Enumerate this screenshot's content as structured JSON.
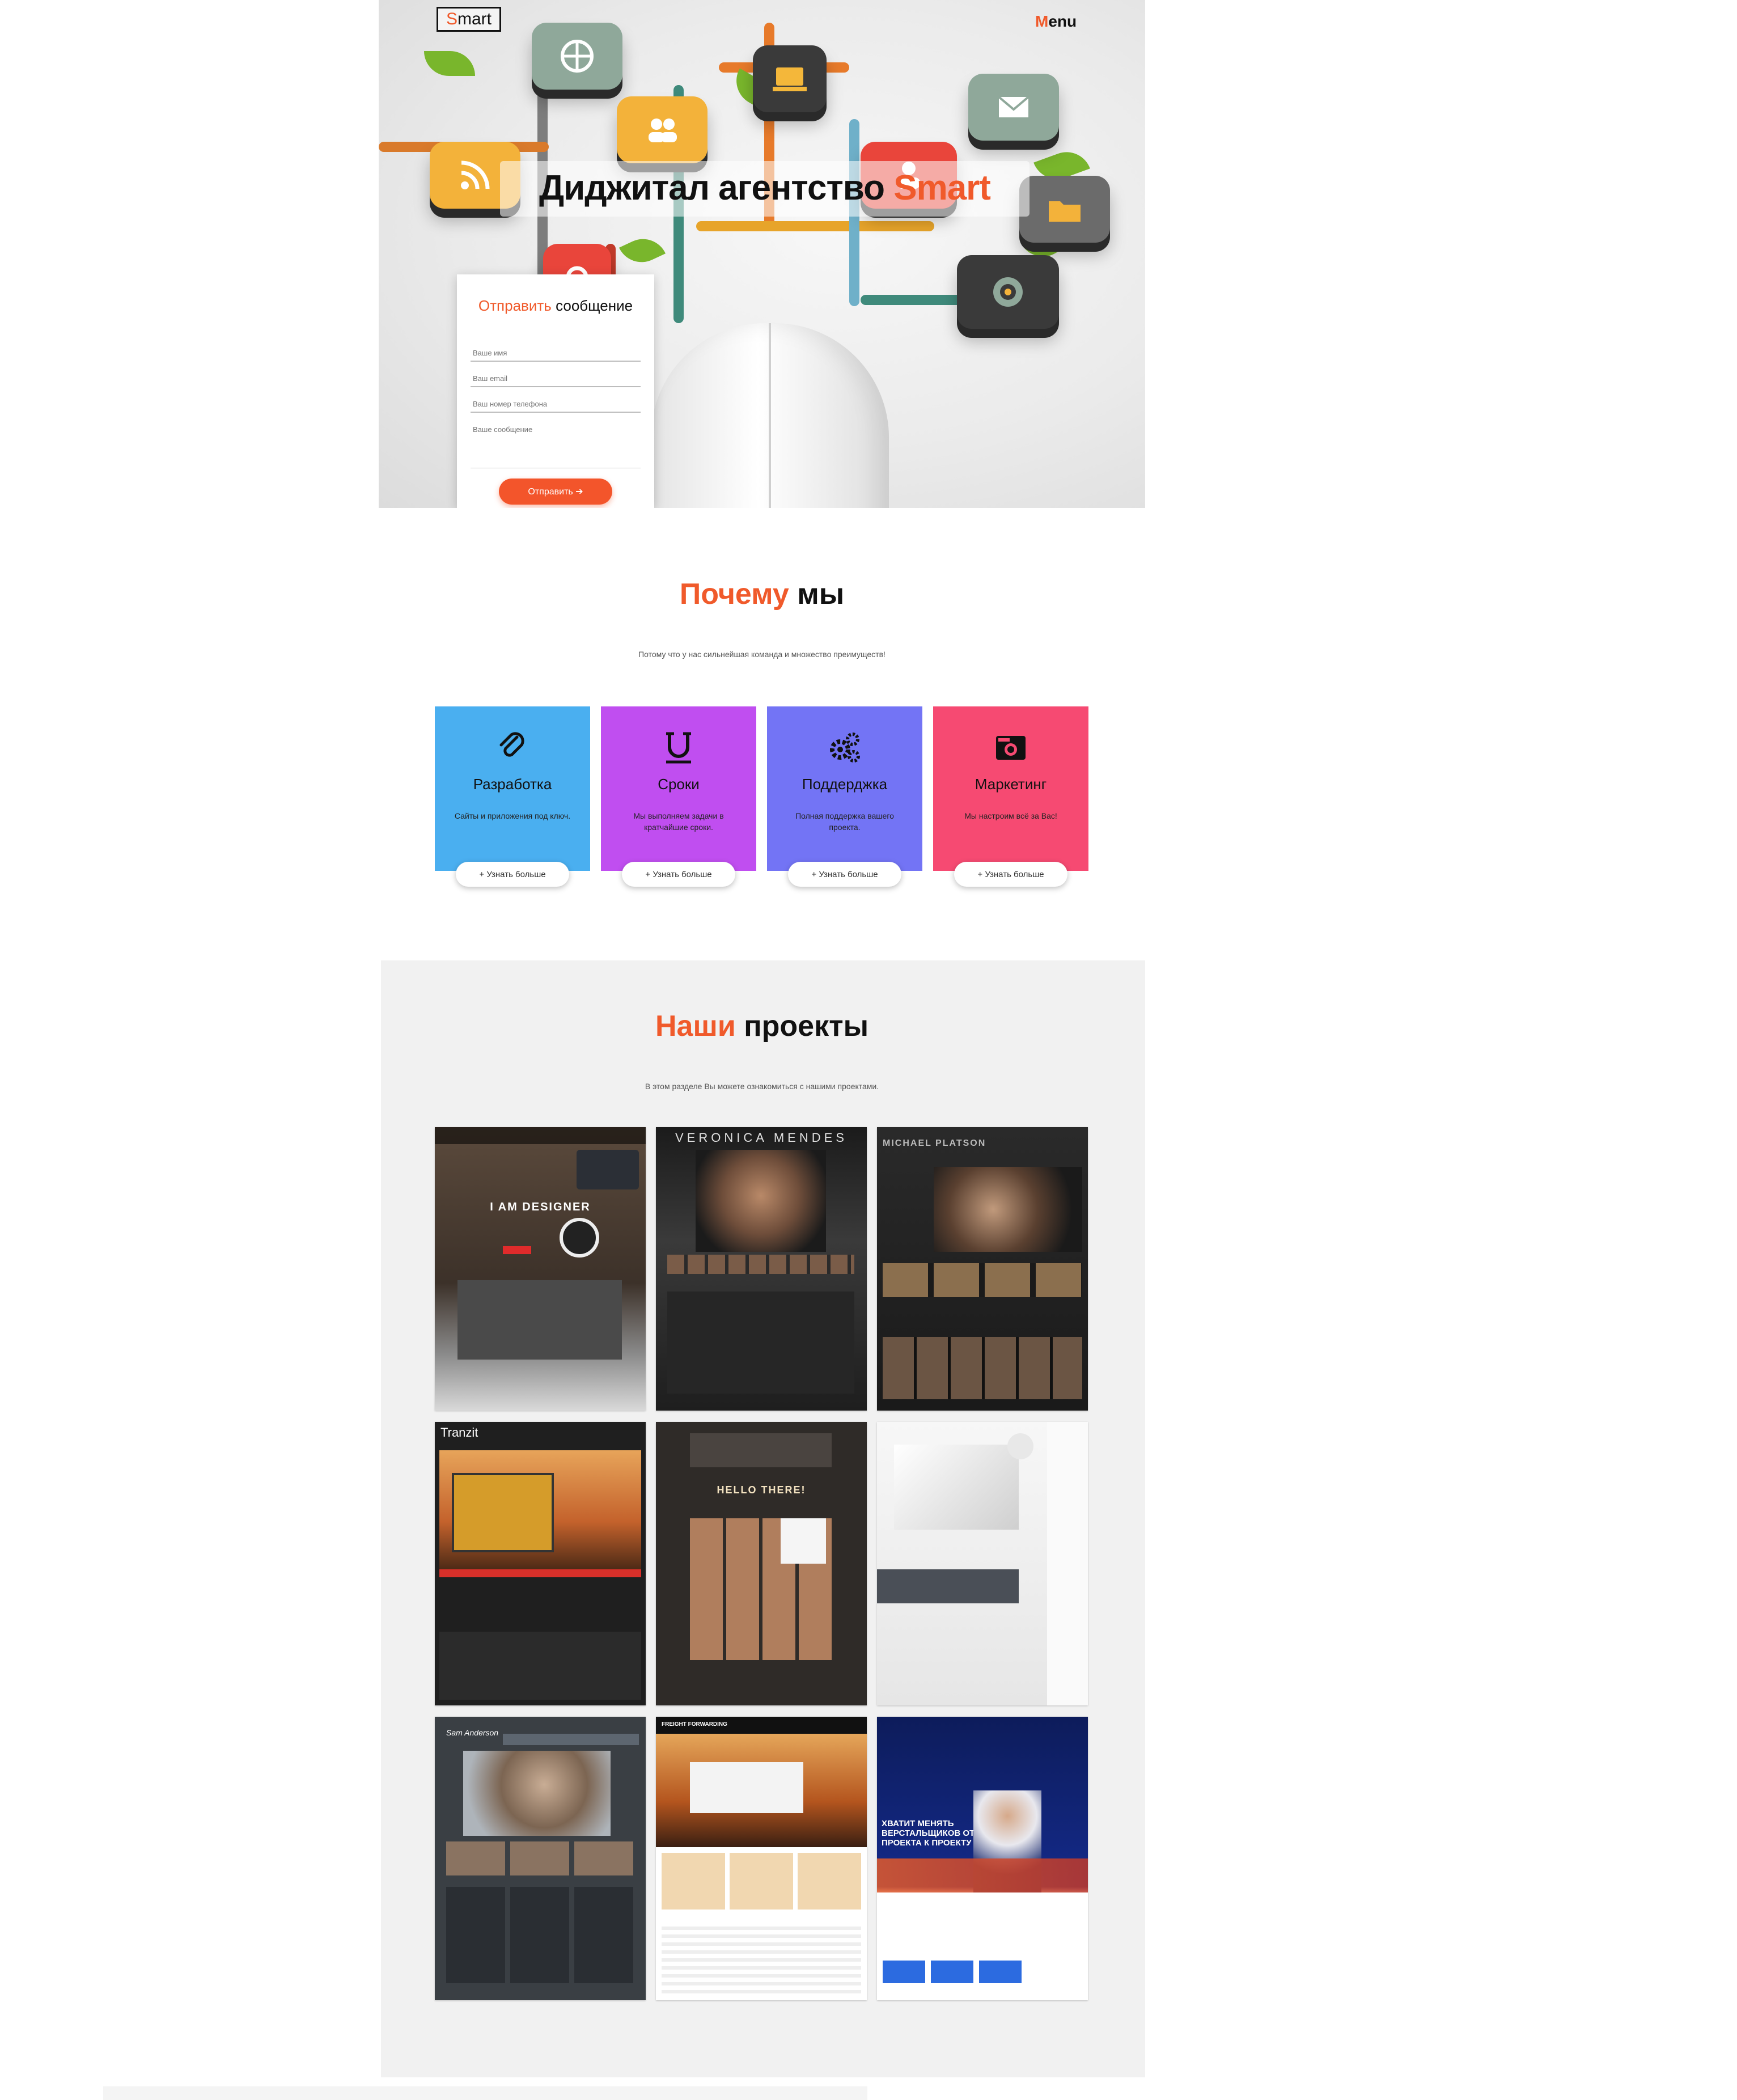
{
  "header": {
    "logo_first": "S",
    "logo_rest": "mart",
    "menu_first": "M",
    "menu_rest": "enu"
  },
  "hero": {
    "title_main": "Диджитал агентство",
    "title_accent": "Smart"
  },
  "contact_form": {
    "title_accent": "Отправить",
    "title_rest": "сообщение",
    "name_placeholder": "Ваше имя",
    "email_placeholder": "Ваш email",
    "phone_placeholder": "Ваш номер телефона",
    "message_placeholder": "Ваше сообщение",
    "submit_label": "Отправить ➔"
  },
  "why_us": {
    "title_accent": "Почему",
    "title_rest": "мы",
    "subtitle": "Потому что у нас сильнейшая команда и множество преимуществ!",
    "features": [
      {
        "title": "Разработка",
        "text": "Сайты и приложения под ключ.",
        "button": "+ Узнать больше",
        "color": "#4aaff0",
        "icon": "paperclip-icon"
      },
      {
        "title": "Сроки",
        "text": "Мы выполняем задачи в кратчайшие сроки.",
        "button": "+ Узнать больше",
        "color": "#c04ef0",
        "icon": "underline-icon"
      },
      {
        "title": "Поддерджка",
        "text": "Полная поддержка вашего проекта.",
        "button": "+ Узнать больше",
        "color": "#7374f5",
        "icon": "gears-icon"
      },
      {
        "title": "Маркетинг",
        "text": "Мы настроим всё за Вас!",
        "button": "+ Узнать больше",
        "color": "#f64a72",
        "icon": "camera-icon"
      }
    ]
  },
  "projects": {
    "title_accent": "Наши",
    "title_rest": "проекты",
    "subtitle": "В этом разделе Вы можете ознакомиться с нашими проектами.",
    "items": [
      {
        "caption": "I AM DESIGNER"
      },
      {
        "caption": "VERONICA MENDES"
      },
      {
        "caption": "MICHAEL PLATSON"
      },
      {
        "caption": "Tranzit"
      },
      {
        "caption": "HELLO THERE!"
      },
      {
        "caption": ""
      },
      {
        "caption": "Sam Anderson"
      },
      {
        "caption": "FREIGHT FORWARDING"
      },
      {
        "caption": "ХВАТИТ МЕНЯТЬ ВЕРСТАЛЬЩИКОВ ОТ ПРОЕКТА К ПРОЕКТУ"
      }
    ]
  }
}
